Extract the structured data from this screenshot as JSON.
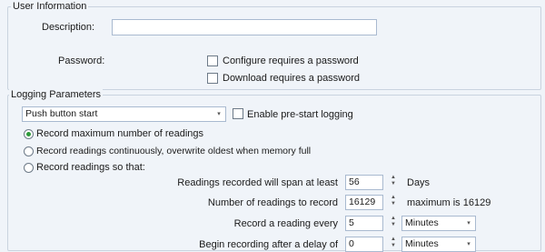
{
  "user_info": {
    "group_title": "User Information",
    "description_label": "Description:",
    "description_value": "",
    "password_label": "Password:",
    "configure_password_label": "Configure requires a password",
    "configure_password_checked": false,
    "download_password_label": "Download requires a password",
    "download_password_checked": false
  },
  "logging": {
    "group_title": "Logging Parameters",
    "start_mode_value": "Push button start",
    "enable_prestart_label": "Enable pre-start logging",
    "enable_prestart_checked": false,
    "radio_max_label": "Record maximum number of readings",
    "radio_continuous_label": "Record readings continuously, overwrite oldest when memory full",
    "radio_so_that_label": "Record readings so that:",
    "selected_radio": "max",
    "span_label": "Readings recorded will span at least",
    "span_value": "56",
    "span_unit": "Days",
    "count_label": "Number of readings to record",
    "count_value": "16129",
    "count_max_text": "maximum is 16129",
    "interval_label": "Record a reading every",
    "interval_value": "5",
    "interval_unit": "Minutes",
    "delay_label": "Begin recording after a delay of",
    "delay_value": "0",
    "delay_unit": "Minutes"
  },
  "icons": {
    "combo_arrow": "▾",
    "spin_up": "▲",
    "spin_down": "▼"
  }
}
